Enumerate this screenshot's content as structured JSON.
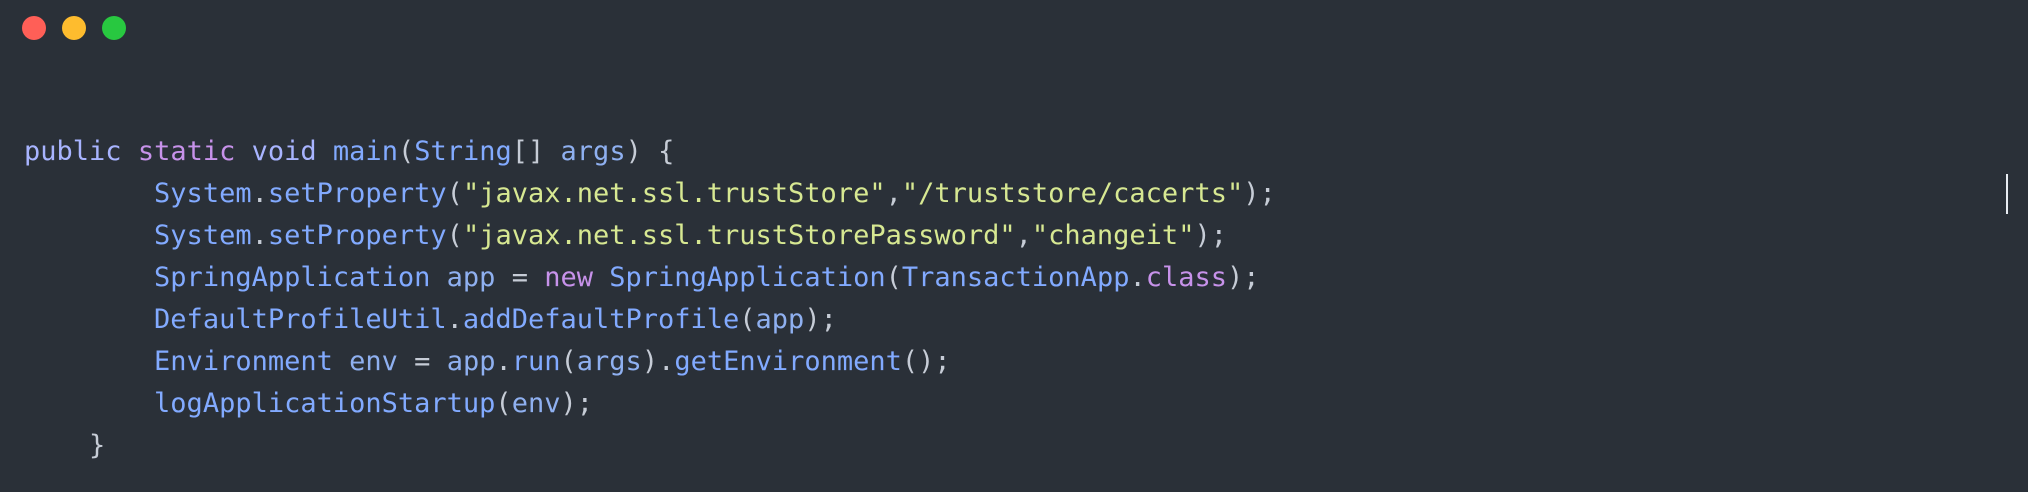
{
  "window": {
    "controls": [
      "close",
      "minimize",
      "maximize"
    ]
  },
  "code": {
    "lines": [
      {
        "indent": "",
        "tokens": [
          {
            "t": "public",
            "k": "kw2"
          },
          {
            "t": " ",
            "k": "pn"
          },
          {
            "t": "static",
            "k": "kw"
          },
          {
            "t": " ",
            "k": "pn"
          },
          {
            "t": "void",
            "k": "kw2"
          },
          {
            "t": " ",
            "k": "pn"
          },
          {
            "t": "main",
            "k": "fn"
          },
          {
            "t": "(",
            "k": "pn"
          },
          {
            "t": "String",
            "k": "ty"
          },
          {
            "t": "[] ",
            "k": "pn"
          },
          {
            "t": "args",
            "k": "id"
          },
          {
            "t": ") {",
            "k": "pn"
          }
        ]
      },
      {
        "indent": "        ",
        "tokens": [
          {
            "t": "System",
            "k": "ty"
          },
          {
            "t": ".",
            "k": "pn"
          },
          {
            "t": "setProperty",
            "k": "fn"
          },
          {
            "t": "(",
            "k": "pn"
          },
          {
            "t": "\"javax.net.ssl.trustStore\"",
            "k": "str"
          },
          {
            "t": ",",
            "k": "pn"
          },
          {
            "t": "\"/truststore/cacerts\"",
            "k": "str"
          },
          {
            "t": ");",
            "k": "pn"
          }
        ]
      },
      {
        "indent": "        ",
        "tokens": [
          {
            "t": "System",
            "k": "ty"
          },
          {
            "t": ".",
            "k": "pn"
          },
          {
            "t": "setProperty",
            "k": "fn"
          },
          {
            "t": "(",
            "k": "pn"
          },
          {
            "t": "\"javax.net.ssl.trustStorePassword\"",
            "k": "str"
          },
          {
            "t": ",",
            "k": "pn"
          },
          {
            "t": "\"changeit\"",
            "k": "str"
          },
          {
            "t": ");",
            "k": "pn"
          }
        ]
      },
      {
        "indent": "        ",
        "tokens": [
          {
            "t": "SpringApplication",
            "k": "ty"
          },
          {
            "t": " ",
            "k": "pn"
          },
          {
            "t": "app",
            "k": "id"
          },
          {
            "t": " = ",
            "k": "pn"
          },
          {
            "t": "new",
            "k": "kw"
          },
          {
            "t": " ",
            "k": "pn"
          },
          {
            "t": "SpringApplication",
            "k": "ty"
          },
          {
            "t": "(",
            "k": "pn"
          },
          {
            "t": "TransactionApp",
            "k": "ty"
          },
          {
            "t": ".",
            "k": "pn"
          },
          {
            "t": "class",
            "k": "kw"
          },
          {
            "t": ");",
            "k": "pn"
          }
        ]
      },
      {
        "indent": "        ",
        "tokens": [
          {
            "t": "DefaultProfileUtil",
            "k": "ty"
          },
          {
            "t": ".",
            "k": "pn"
          },
          {
            "t": "addDefaultProfile",
            "k": "fn"
          },
          {
            "t": "(",
            "k": "pn"
          },
          {
            "t": "app",
            "k": "id"
          },
          {
            "t": ");",
            "k": "pn"
          }
        ]
      },
      {
        "indent": "        ",
        "tokens": [
          {
            "t": "Environment",
            "k": "ty"
          },
          {
            "t": " ",
            "k": "pn"
          },
          {
            "t": "env",
            "k": "id"
          },
          {
            "t": " = ",
            "k": "pn"
          },
          {
            "t": "app",
            "k": "id"
          },
          {
            "t": ".",
            "k": "pn"
          },
          {
            "t": "run",
            "k": "fn"
          },
          {
            "t": "(",
            "k": "pn"
          },
          {
            "t": "args",
            "k": "id"
          },
          {
            "t": ").",
            "k": "pn"
          },
          {
            "t": "getEnvironment",
            "k": "fn"
          },
          {
            "t": "();",
            "k": "pn"
          }
        ]
      },
      {
        "indent": "        ",
        "tokens": [
          {
            "t": "logApplicationStartup",
            "k": "fn"
          },
          {
            "t": "(",
            "k": "pn"
          },
          {
            "t": "env",
            "k": "id"
          },
          {
            "t": ");",
            "k": "pn"
          }
        ]
      },
      {
        "indent": "    ",
        "tokens": [
          {
            "t": "}",
            "k": "pn"
          }
        ]
      }
    ]
  },
  "colors": {
    "background": "#2a3038",
    "close": "#ff5f57",
    "minimize": "#febc2e",
    "maximize": "#28c840"
  }
}
